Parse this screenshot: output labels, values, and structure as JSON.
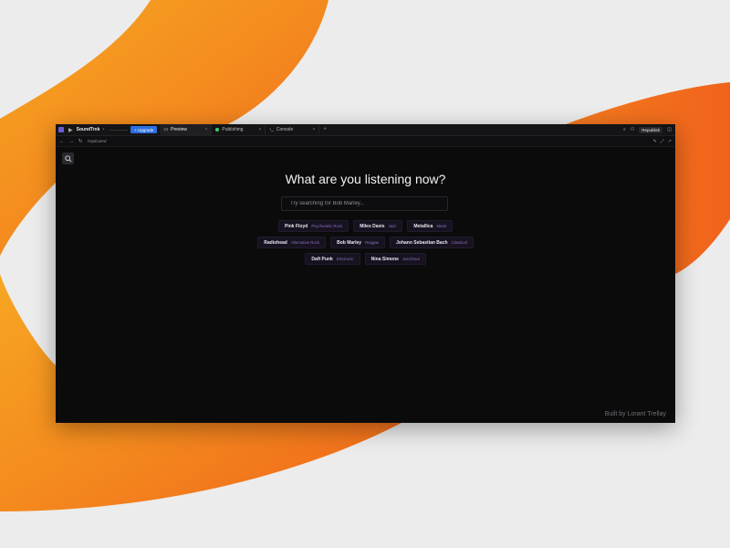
{
  "topbar": {
    "app_name": "SoundTrek",
    "upgrade_label": "+ Upgrade",
    "tabs": [
      {
        "label": "Preview"
      },
      {
        "label": "Publishing"
      },
      {
        "label": "Console"
      }
    ],
    "republish_label": "Republish"
  },
  "address": {
    "url": "/replicated"
  },
  "main": {
    "headline": "What are you listening now?",
    "search_placeholder": "Try searching for Bob Marley...",
    "chip_rows": [
      [
        {
          "artist": "Pink Floyd",
          "genre": "Psychedelic Rock"
        },
        {
          "artist": "Miles Davis",
          "genre": "Jazz"
        },
        {
          "artist": "Metallica",
          "genre": "Metal"
        }
      ],
      [
        {
          "artist": "Radiohead",
          "genre": "Alternative Rock"
        },
        {
          "artist": "Bob Marley",
          "genre": "Reggae"
        },
        {
          "artist": "Johann Sebastian Bach",
          "genre": "Classical"
        }
      ],
      [
        {
          "artist": "Daft Punk",
          "genre": "Electronic"
        },
        {
          "artist": "Nina Simone",
          "genre": "Jazz/Soul"
        }
      ]
    ],
    "credit": "Built by Lorant Trellay"
  },
  "colors": {
    "background_orange": "#f47a1f",
    "window_bg": "#0b0b0c",
    "accent_blue": "#2d6fe0",
    "chip_genre": "#8d6fbf"
  }
}
